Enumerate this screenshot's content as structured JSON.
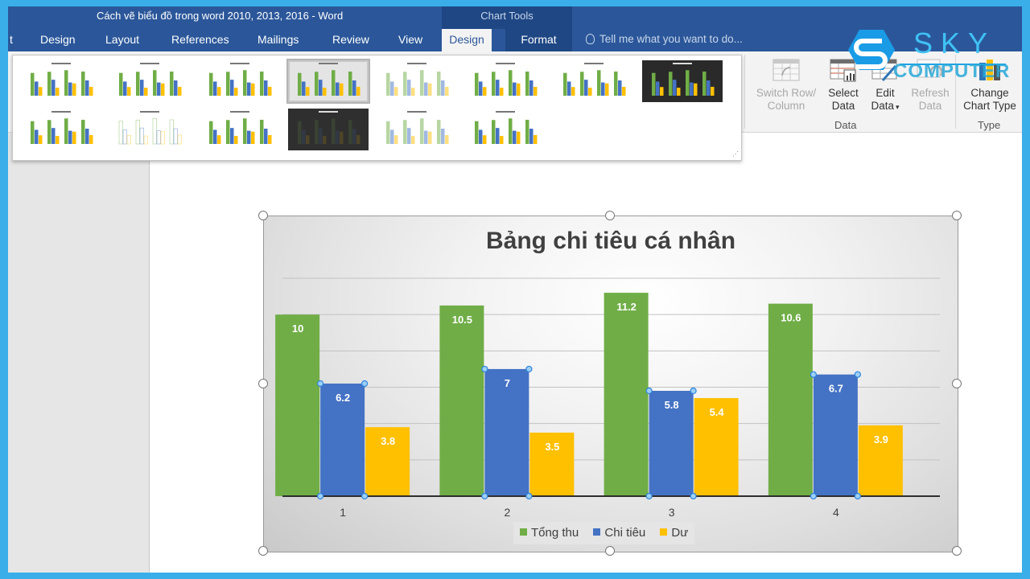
{
  "window": {
    "title": "Cách vẽ biểu đồ trong word 2010, 2013, 2016 - Word",
    "context_tab_group": "Chart Tools"
  },
  "tabs": [
    {
      "label": "t",
      "state": "partial"
    },
    {
      "label": "Design"
    },
    {
      "label": "Layout"
    },
    {
      "label": "References"
    },
    {
      "label": "Mailings"
    },
    {
      "label": "Review"
    },
    {
      "label": "View"
    },
    {
      "label": "Design",
      "active": true
    },
    {
      "label": "Format"
    }
  ],
  "tell_me": {
    "placeholder": "Tell me what you want to do..."
  },
  "gallery": {
    "styles": [
      {
        "style": "Style 1",
        "theme": "light"
      },
      {
        "style": "Style 2",
        "theme": "light"
      },
      {
        "style": "Style 3",
        "theme": "light-striped"
      },
      {
        "style": "Style 4",
        "theme": "gradient",
        "selected": true
      },
      {
        "style": "Style 5",
        "theme": "pale"
      },
      {
        "style": "Style 6",
        "theme": "light"
      },
      {
        "style": "Style 7",
        "theme": "hatched"
      },
      {
        "style": "Style 8",
        "theme": "dark"
      },
      {
        "style": "Style 9",
        "theme": "light"
      },
      {
        "style": "Style 10",
        "theme": "outline"
      },
      {
        "style": "Style 11",
        "theme": "light"
      },
      {
        "style": "Style 12",
        "theme": "dark-faint"
      },
      {
        "style": "Style 13",
        "theme": "pale"
      },
      {
        "style": "Style 14",
        "theme": "light"
      }
    ]
  },
  "ribbon": {
    "data_group": {
      "label": "Data",
      "buttons": [
        {
          "label_line1": "Switch Row/",
          "label_line2": "Column",
          "enabled": false,
          "icon": "switch-row-column-icon"
        },
        {
          "label_line1": "Select",
          "label_line2": "Data",
          "enabled": true,
          "icon": "select-data-icon"
        },
        {
          "label_line1": "Edit",
          "label_line2": "Data",
          "dropdown": "▾",
          "enabled": true,
          "icon": "edit-data-icon"
        },
        {
          "label_line1": "Refresh",
          "label_line2": "Data",
          "enabled": false,
          "icon": "refresh-data-icon"
        }
      ]
    },
    "type_group": {
      "label": "Type",
      "buttons": [
        {
          "label_line1": "Change",
          "label_line2": "Chart Type",
          "enabled": true,
          "icon": "change-chart-type-icon"
        }
      ]
    }
  },
  "watermark": {
    "line1": "SKY",
    "line2": "COMPUTER"
  },
  "colors": {
    "ribbon_blue": "#2b579a",
    "chart_tools_blue": "#1f4784",
    "border_blue": "#3aaee8",
    "series_green": "#70ad47",
    "series_blue": "#4472c4",
    "series_yellow": "#ffc000"
  },
  "chart_data": {
    "type": "bar",
    "title": "Bảng chi tiêu cá nhân",
    "categories": [
      "1",
      "2",
      "3",
      "4"
    ],
    "series": [
      {
        "name": "Tổng thu",
        "color": "#70ad47",
        "values": [
          10,
          10.5,
          11.2,
          10.6
        ]
      },
      {
        "name": "Chi tiêu",
        "color": "#4472c4",
        "values": [
          6.2,
          7,
          5.8,
          6.7
        ],
        "selected": true
      },
      {
        "name": "Dư",
        "color": "#ffc000",
        "values": [
          3.8,
          3.5,
          5.4,
          3.9
        ]
      }
    ],
    "data_labels": true,
    "xlabel": "",
    "ylabel": "",
    "ylim": [
      0,
      12
    ],
    "gridline_step": 2,
    "grid": true,
    "y_axis_visible": false,
    "legend": "bottom"
  }
}
